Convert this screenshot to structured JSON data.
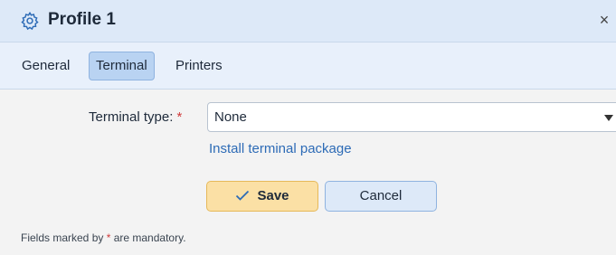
{
  "window": {
    "title": "Profile 1",
    "close_label": "×",
    "title_icon": "gear-icon"
  },
  "tabs": [
    {
      "label": "General",
      "active": false
    },
    {
      "label": "Terminal",
      "active": true
    },
    {
      "label": "Printers",
      "active": false
    }
  ],
  "form": {
    "terminal_type_label": "Terminal type:",
    "required_marker": "*",
    "terminal_type_value": "None",
    "install_link": "Install terminal package"
  },
  "buttons": {
    "save_label": "Save",
    "cancel_label": "Cancel"
  },
  "footer": {
    "note_prefix": "Fields marked by ",
    "required_marker": "*",
    "note_suffix": " are mandatory."
  },
  "colors": {
    "accent": "#2d6bb6",
    "required": "#d03a3a",
    "save_bg": "#fbe0a5",
    "active_tab_bg": "#b9d3f2"
  }
}
